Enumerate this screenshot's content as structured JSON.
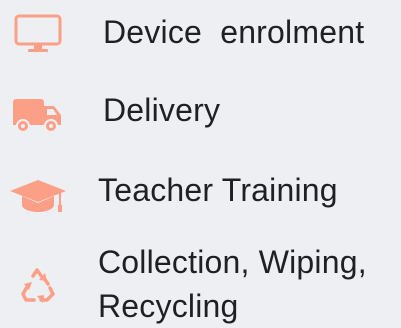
{
  "accent_color": "#fb9f86",
  "items": [
    {
      "icon": "monitor-icon",
      "label": "Device  enrolment"
    },
    {
      "icon": "truck-icon",
      "label": "Delivery"
    },
    {
      "icon": "graduation-cap-icon",
      "label": "Teacher Training"
    },
    {
      "icon": "recycle-icon",
      "label": "Collection, Wiping, Recycling"
    }
  ]
}
